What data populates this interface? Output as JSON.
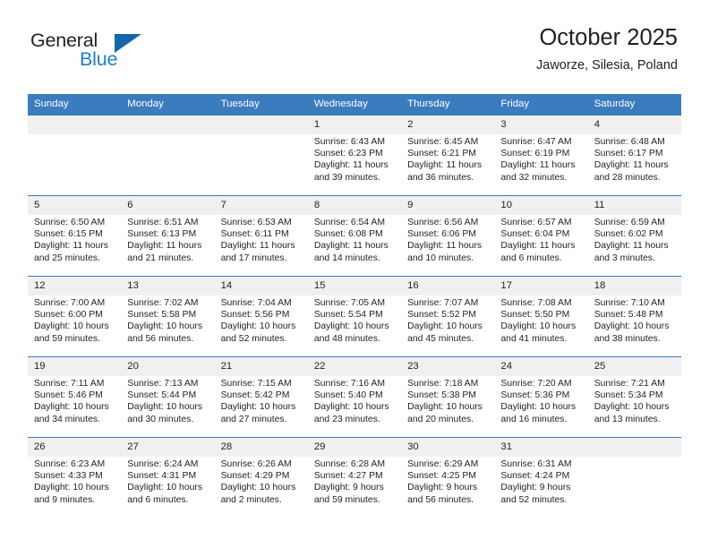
{
  "brand": {
    "name_part1": "General",
    "name_part2": "Blue"
  },
  "header": {
    "title": "October 2025",
    "subtitle": "Jaworze, Silesia, Poland"
  },
  "weekday_headers": [
    "Sunday",
    "Monday",
    "Tuesday",
    "Wednesday",
    "Thursday",
    "Friday",
    "Saturday"
  ],
  "colors": {
    "header_blue": "#3b7cbf",
    "brand_blue": "#1f7ec4",
    "daynum_bg": "#f0f0f0",
    "text": "#231f20"
  },
  "weeks": [
    [
      {
        "day": "",
        "empty": true
      },
      {
        "day": "",
        "empty": true
      },
      {
        "day": "",
        "empty": true
      },
      {
        "day": "1",
        "sunrise": "Sunrise: 6:43 AM",
        "sunset": "Sunset: 6:23 PM",
        "daylight1": "Daylight: 11 hours",
        "daylight2": "and 39 minutes."
      },
      {
        "day": "2",
        "sunrise": "Sunrise: 6:45 AM",
        "sunset": "Sunset: 6:21 PM",
        "daylight1": "Daylight: 11 hours",
        "daylight2": "and 36 minutes."
      },
      {
        "day": "3",
        "sunrise": "Sunrise: 6:47 AM",
        "sunset": "Sunset: 6:19 PM",
        "daylight1": "Daylight: 11 hours",
        "daylight2": "and 32 minutes."
      },
      {
        "day": "4",
        "sunrise": "Sunrise: 6:48 AM",
        "sunset": "Sunset: 6:17 PM",
        "daylight1": "Daylight: 11 hours",
        "daylight2": "and 28 minutes."
      }
    ],
    [
      {
        "day": "5",
        "sunrise": "Sunrise: 6:50 AM",
        "sunset": "Sunset: 6:15 PM",
        "daylight1": "Daylight: 11 hours",
        "daylight2": "and 25 minutes."
      },
      {
        "day": "6",
        "sunrise": "Sunrise: 6:51 AM",
        "sunset": "Sunset: 6:13 PM",
        "daylight1": "Daylight: 11 hours",
        "daylight2": "and 21 minutes."
      },
      {
        "day": "7",
        "sunrise": "Sunrise: 6:53 AM",
        "sunset": "Sunset: 6:11 PM",
        "daylight1": "Daylight: 11 hours",
        "daylight2": "and 17 minutes."
      },
      {
        "day": "8",
        "sunrise": "Sunrise: 6:54 AM",
        "sunset": "Sunset: 6:08 PM",
        "daylight1": "Daylight: 11 hours",
        "daylight2": "and 14 minutes."
      },
      {
        "day": "9",
        "sunrise": "Sunrise: 6:56 AM",
        "sunset": "Sunset: 6:06 PM",
        "daylight1": "Daylight: 11 hours",
        "daylight2": "and 10 minutes."
      },
      {
        "day": "10",
        "sunrise": "Sunrise: 6:57 AM",
        "sunset": "Sunset: 6:04 PM",
        "daylight1": "Daylight: 11 hours",
        "daylight2": "and 6 minutes."
      },
      {
        "day": "11",
        "sunrise": "Sunrise: 6:59 AM",
        "sunset": "Sunset: 6:02 PM",
        "daylight1": "Daylight: 11 hours",
        "daylight2": "and 3 minutes."
      }
    ],
    [
      {
        "day": "12",
        "sunrise": "Sunrise: 7:00 AM",
        "sunset": "Sunset: 6:00 PM",
        "daylight1": "Daylight: 10 hours",
        "daylight2": "and 59 minutes."
      },
      {
        "day": "13",
        "sunrise": "Sunrise: 7:02 AM",
        "sunset": "Sunset: 5:58 PM",
        "daylight1": "Daylight: 10 hours",
        "daylight2": "and 56 minutes."
      },
      {
        "day": "14",
        "sunrise": "Sunrise: 7:04 AM",
        "sunset": "Sunset: 5:56 PM",
        "daylight1": "Daylight: 10 hours",
        "daylight2": "and 52 minutes."
      },
      {
        "day": "15",
        "sunrise": "Sunrise: 7:05 AM",
        "sunset": "Sunset: 5:54 PM",
        "daylight1": "Daylight: 10 hours",
        "daylight2": "and 48 minutes."
      },
      {
        "day": "16",
        "sunrise": "Sunrise: 7:07 AM",
        "sunset": "Sunset: 5:52 PM",
        "daylight1": "Daylight: 10 hours",
        "daylight2": "and 45 minutes."
      },
      {
        "day": "17",
        "sunrise": "Sunrise: 7:08 AM",
        "sunset": "Sunset: 5:50 PM",
        "daylight1": "Daylight: 10 hours",
        "daylight2": "and 41 minutes."
      },
      {
        "day": "18",
        "sunrise": "Sunrise: 7:10 AM",
        "sunset": "Sunset: 5:48 PM",
        "daylight1": "Daylight: 10 hours",
        "daylight2": "and 38 minutes."
      }
    ],
    [
      {
        "day": "19",
        "sunrise": "Sunrise: 7:11 AM",
        "sunset": "Sunset: 5:46 PM",
        "daylight1": "Daylight: 10 hours",
        "daylight2": "and 34 minutes."
      },
      {
        "day": "20",
        "sunrise": "Sunrise: 7:13 AM",
        "sunset": "Sunset: 5:44 PM",
        "daylight1": "Daylight: 10 hours",
        "daylight2": "and 30 minutes."
      },
      {
        "day": "21",
        "sunrise": "Sunrise: 7:15 AM",
        "sunset": "Sunset: 5:42 PM",
        "daylight1": "Daylight: 10 hours",
        "daylight2": "and 27 minutes."
      },
      {
        "day": "22",
        "sunrise": "Sunrise: 7:16 AM",
        "sunset": "Sunset: 5:40 PM",
        "daylight1": "Daylight: 10 hours",
        "daylight2": "and 23 minutes."
      },
      {
        "day": "23",
        "sunrise": "Sunrise: 7:18 AM",
        "sunset": "Sunset: 5:38 PM",
        "daylight1": "Daylight: 10 hours",
        "daylight2": "and 20 minutes."
      },
      {
        "day": "24",
        "sunrise": "Sunrise: 7:20 AM",
        "sunset": "Sunset: 5:36 PM",
        "daylight1": "Daylight: 10 hours",
        "daylight2": "and 16 minutes."
      },
      {
        "day": "25",
        "sunrise": "Sunrise: 7:21 AM",
        "sunset": "Sunset: 5:34 PM",
        "daylight1": "Daylight: 10 hours",
        "daylight2": "and 13 minutes."
      }
    ],
    [
      {
        "day": "26",
        "sunrise": "Sunrise: 6:23 AM",
        "sunset": "Sunset: 4:33 PM",
        "daylight1": "Daylight: 10 hours",
        "daylight2": "and 9 minutes."
      },
      {
        "day": "27",
        "sunrise": "Sunrise: 6:24 AM",
        "sunset": "Sunset: 4:31 PM",
        "daylight1": "Daylight: 10 hours",
        "daylight2": "and 6 minutes."
      },
      {
        "day": "28",
        "sunrise": "Sunrise: 6:26 AM",
        "sunset": "Sunset: 4:29 PM",
        "daylight1": "Daylight: 10 hours",
        "daylight2": "and 2 minutes."
      },
      {
        "day": "29",
        "sunrise": "Sunrise: 6:28 AM",
        "sunset": "Sunset: 4:27 PM",
        "daylight1": "Daylight: 9 hours",
        "daylight2": "and 59 minutes."
      },
      {
        "day": "30",
        "sunrise": "Sunrise: 6:29 AM",
        "sunset": "Sunset: 4:25 PM",
        "daylight1": "Daylight: 9 hours",
        "daylight2": "and 56 minutes."
      },
      {
        "day": "31",
        "sunrise": "Sunrise: 6:31 AM",
        "sunset": "Sunset: 4:24 PM",
        "daylight1": "Daylight: 9 hours",
        "daylight2": "and 52 minutes."
      },
      {
        "day": "",
        "empty": true
      }
    ]
  ]
}
